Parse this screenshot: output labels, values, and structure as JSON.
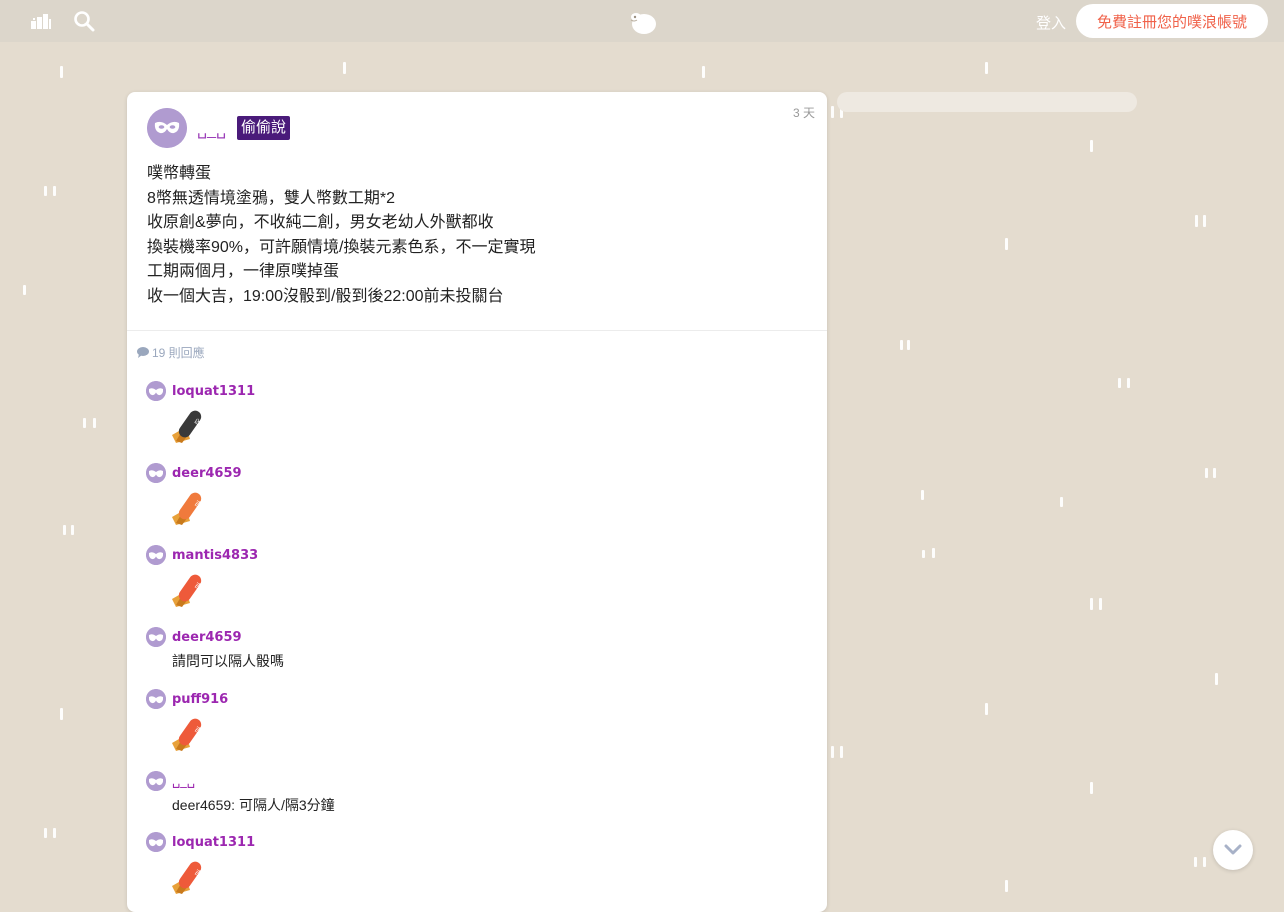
{
  "topbar": {
    "login_label": "登入",
    "signup_label": "免費註冊您的噗浪帳號"
  },
  "post": {
    "author": "␣_␣",
    "qualifier": "偷偷說",
    "time": "3 天",
    "lines": [
      "噗幣轉蛋",
      "8幣無透情境塗鴉，雙人幣數工期*2",
      "收原創&夢向，不收純二創，男女老幼人外獸都收",
      "換裝機率90%，可許願情境/換裝元素色系，不一定實現",
      "工期兩個月，一律原噗掉蛋",
      "收一個大吉，19:00沒骰到/骰到後22:00前未投關台"
    ],
    "response_count": "19 則回應"
  },
  "responses": [
    {
      "name": "loquat1311",
      "sticker": "dark-fortune-stick",
      "text": ""
    },
    {
      "name": "deer4659",
      "sticker": "orange-fortune-stick",
      "text": ""
    },
    {
      "name": "mantis4833",
      "sticker": "red-fortune-stick",
      "text": ""
    },
    {
      "name": "deer4659",
      "sticker": "",
      "text": "請問可以隔人骰嗎"
    },
    {
      "name": "puff916",
      "sticker": "red-fortune-stick",
      "text": ""
    },
    {
      "name": "␣_␣",
      "sticker": "",
      "text": "deer4659: 可隔人/隔3分鐘"
    },
    {
      "name": "loquat1311",
      "sticker": "red-fortune-stick",
      "text": ""
    }
  ],
  "colors": {
    "background": "#e4dccf",
    "accent": "#f0624a",
    "username": "#9c27b0",
    "qualifier_bg": "#4a1b7a"
  }
}
